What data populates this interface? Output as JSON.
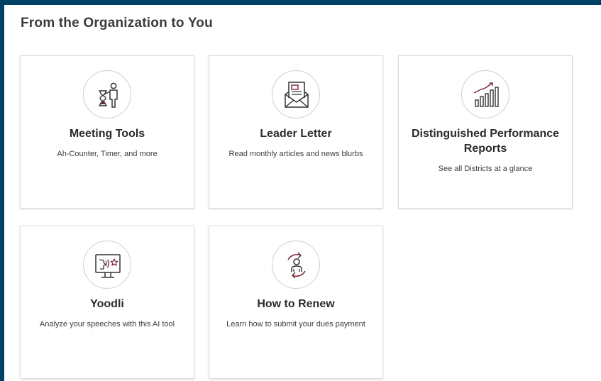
{
  "section": {
    "title": "From the Organization to You"
  },
  "colors": {
    "background_frame": "#004165",
    "icon_accent": "#772432",
    "icon_stroke": "#333333"
  },
  "cards": [
    {
      "title": "Meeting Tools",
      "description": "Ah-Counter, Timer, and more",
      "icon": "hourglass-presenter-icon"
    },
    {
      "title": "Leader Letter",
      "description": "Read monthly articles and news blurbs",
      "icon": "envelope-letter-icon"
    },
    {
      "title": "Distinguished Performance Reports",
      "description": "See all Districts at a glance",
      "icon": "bar-chart-trend-icon"
    },
    {
      "title": "Yoodli",
      "description": "Analyze your speeches with this AI tool",
      "icon": "monitor-speech-star-icon"
    },
    {
      "title": "How to Renew",
      "description": "Learn how to submit your dues payment",
      "icon": "renew-person-cycle-icon"
    }
  ]
}
